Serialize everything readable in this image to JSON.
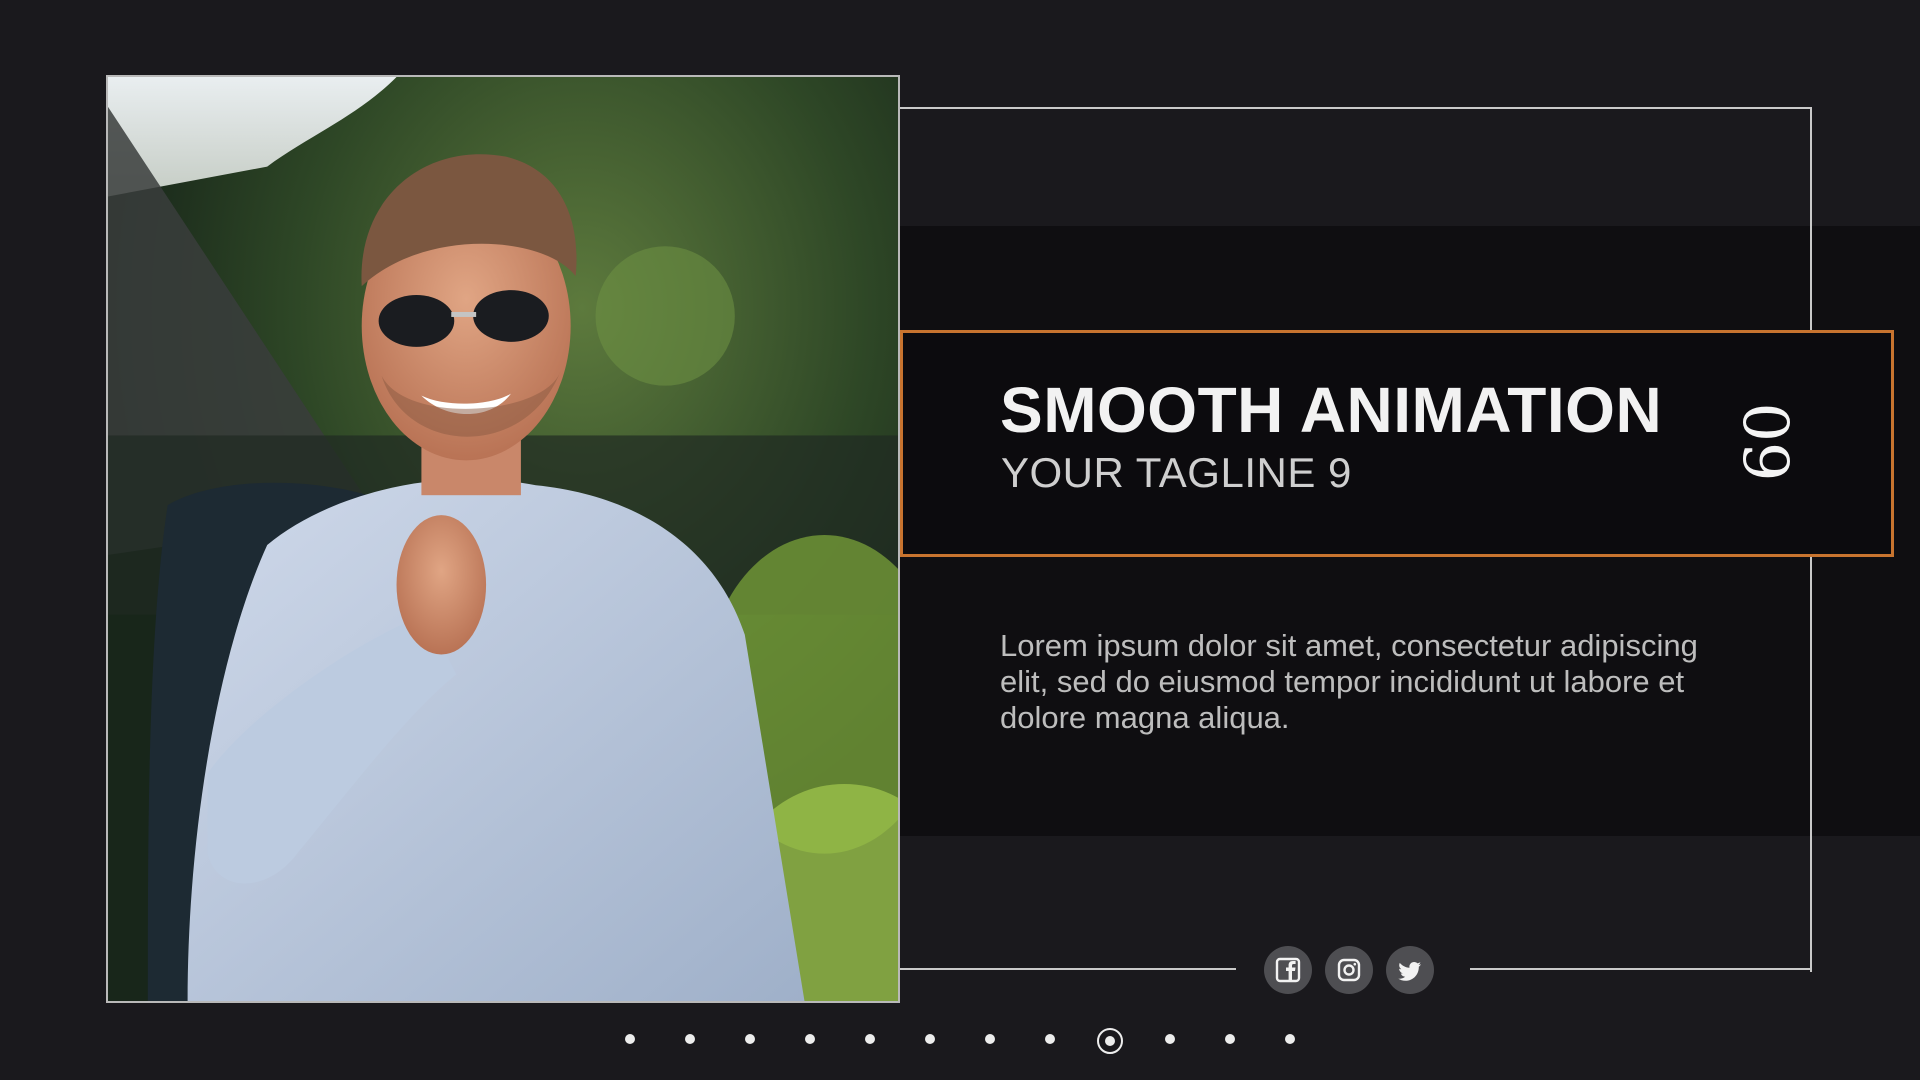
{
  "slide": {
    "title": "SMOOTH ANIMATION",
    "tagline": "YOUR TAGLINE 9",
    "number": "09",
    "body": "Lorem ipsum dolor sit amet, consectetur adipiscing elit, sed do eiusmod tempor incididunt ut labore et dolore magna aliqua."
  },
  "socials": [
    {
      "name": "facebook",
      "icon": "facebook-icon"
    },
    {
      "name": "instagram",
      "icon": "instagram-icon"
    },
    {
      "name": "twitter",
      "icon": "twitter-icon"
    }
  ],
  "pagination": {
    "total": 12,
    "current": 9
  },
  "colors": {
    "background": "#1a191d",
    "accent": "#c8742f",
    "frame": "#c9c9c9"
  }
}
